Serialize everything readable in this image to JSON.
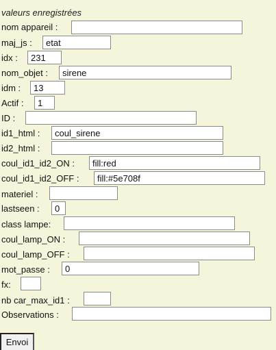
{
  "form": {
    "title": "valeurs enregistrées",
    "submit_label": "Envoi",
    "fields": {
      "nom_appareil": {
        "label": "nom appareil :",
        "value": ""
      },
      "maj_js": {
        "label": "maj_js :",
        "value": "etat"
      },
      "idx": {
        "label": "idx :",
        "value": "231"
      },
      "nom_objet": {
        "label": "nom_objet :",
        "value": "sirene"
      },
      "idm": {
        "label": "idm :",
        "value": "13"
      },
      "actif": {
        "label": "Actif :",
        "value": "1"
      },
      "id": {
        "label": "ID :",
        "value": ""
      },
      "id1_html": {
        "label": "id1_html :",
        "value": "coul_sirene"
      },
      "id2_html": {
        "label": "id2_html :",
        "value": ""
      },
      "coul_id1_id2_on": {
        "label": "coul_id1_id2_ON :",
        "value": "fill:red"
      },
      "coul_id1_id2_off": {
        "label": "coul_id1_id2_OFF :",
        "value": "fill:#5e708f"
      },
      "materiel": {
        "label": "materiel :",
        "value": ""
      },
      "lastseen": {
        "label": "lastseen :",
        "value": "0"
      },
      "class_lampe": {
        "label": "class lampe:",
        "value": ""
      },
      "coul_lamp_on": {
        "label": "coul_lamp_ON :",
        "value": ""
      },
      "coul_lamp_off": {
        "label": "coul_lamp_OFF :",
        "value": ""
      },
      "mot_passe": {
        "label": "mot_passe :",
        "value": "0"
      },
      "fx": {
        "label": "fx:",
        "value": ""
      },
      "nb_car_max_id1": {
        "label": "nb car_max_id1 :",
        "value": ""
      },
      "observations": {
        "label": "Observations :",
        "value": ""
      }
    }
  }
}
